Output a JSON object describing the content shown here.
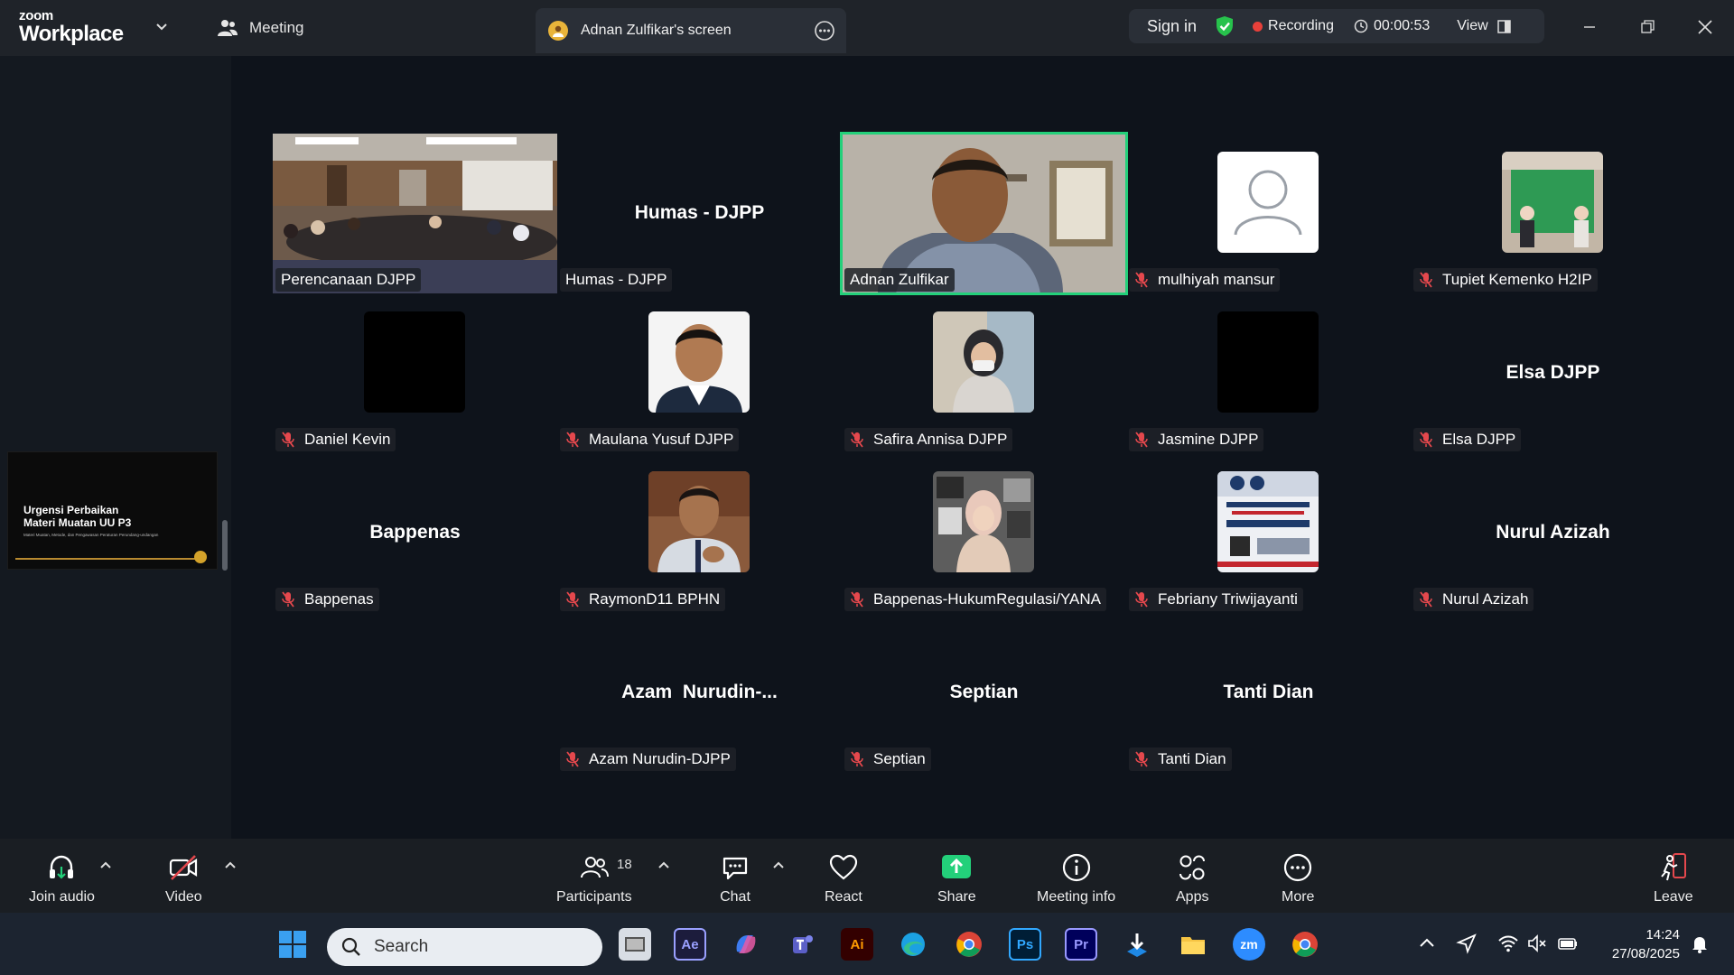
{
  "titlebar": {
    "logo_line1": "zoom",
    "logo_line2": "Workplace",
    "meeting_tab": "Meeting",
    "screen_tab": "Adnan Zulfikar's screen",
    "sign_in": "Sign in",
    "recording": "Recording",
    "timer": "00:00:53",
    "view": "View"
  },
  "shared_preview": {
    "title_line1": "Urgensi Perbaikan",
    "title_line2": "Materi Muatan UU P3",
    "subtitle": "Materi Muatan, Metode, dan Pengawasan Peraturan Perundang-undangan"
  },
  "participants": [
    {
      "name": "Perencanaan DJPP",
      "display": "",
      "muted": false,
      "kind": "video"
    },
    {
      "name": "Humas - DJPP",
      "display": "Humas - DJPP",
      "muted": false,
      "kind": "name"
    },
    {
      "name": "Adnan Zulfikar",
      "display": "",
      "muted": false,
      "kind": "video-active"
    },
    {
      "name": "mulhiyah mansur",
      "display": "",
      "muted": true,
      "kind": "default-avatar"
    },
    {
      "name": "Tupiet Kemenko H2IP",
      "display": "",
      "muted": true,
      "kind": "photo"
    },
    {
      "name": "Daniel Kevin",
      "display": "",
      "muted": true,
      "kind": "black"
    },
    {
      "name": "Maulana Yusuf DJPP",
      "display": "",
      "muted": true,
      "kind": "photo"
    },
    {
      "name": "Safira Annisa DJPP",
      "display": "",
      "muted": true,
      "kind": "photo"
    },
    {
      "name": "Jasmine DJPP",
      "display": "",
      "muted": true,
      "kind": "black"
    },
    {
      "name": "Elsa DJPP",
      "display": "Elsa DJPP",
      "muted": true,
      "kind": "name"
    },
    {
      "name": "Bappenas",
      "display": "Bappenas",
      "muted": true,
      "kind": "name"
    },
    {
      "name": "RaymonD11 BPHN",
      "display": "",
      "muted": true,
      "kind": "photo"
    },
    {
      "name": "Bappenas-HukumRegulasi/YANA",
      "display": "",
      "muted": true,
      "kind": "photo"
    },
    {
      "name": "Febriany Triwijayanti",
      "display": "",
      "muted": true,
      "kind": "photo"
    },
    {
      "name": "Nurul Azizah",
      "display": "Nurul Azizah",
      "muted": true,
      "kind": "name"
    },
    {
      "name": "Azam Nurudin-DJPP",
      "display": "Azam  Nurudin-...",
      "muted": true,
      "kind": "name"
    },
    {
      "name": "Septian",
      "display": "Septian",
      "muted": true,
      "kind": "name"
    },
    {
      "name": "Tanti Dian",
      "display": "Tanti Dian",
      "muted": true,
      "kind": "name"
    }
  ],
  "toolbar": {
    "join_audio": "Join audio",
    "video": "Video",
    "participants": "Participants",
    "participants_count": "18",
    "chat": "Chat",
    "react": "React",
    "share": "Share",
    "meeting_info": "Meeting info",
    "apps": "Apps",
    "more": "More",
    "leave": "Leave"
  },
  "taskbar": {
    "search_placeholder": "Search",
    "time": "14:24",
    "date": "27/08/2025"
  },
  "colors": {
    "active_speaker": "#23d07a",
    "share_green": "#23d07a",
    "recording_red": "#e8403a",
    "muted_red": "#e5484d"
  }
}
